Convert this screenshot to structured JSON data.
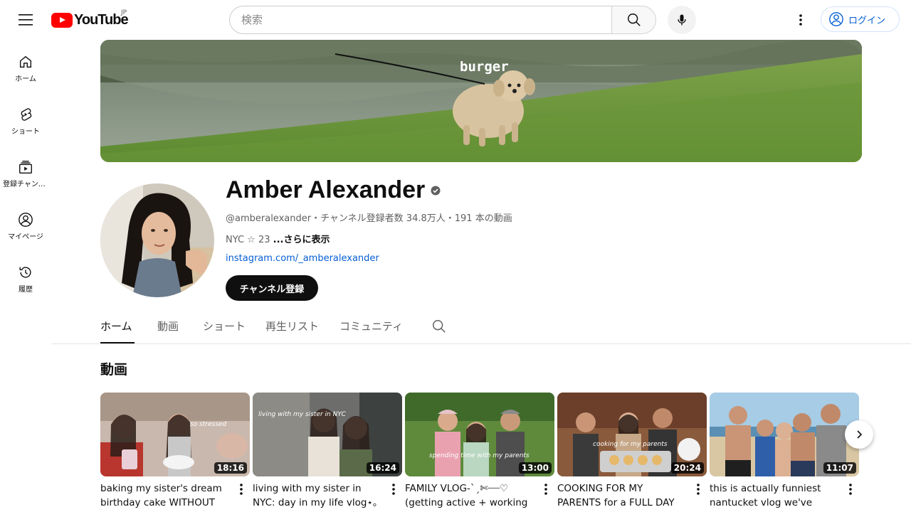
{
  "header": {
    "logo_text": "YouTube",
    "region": "JP",
    "search_placeholder": "検索",
    "login_label": "ログイン"
  },
  "sidebar": {
    "items": [
      {
        "label": "ホーム",
        "icon": "home-icon"
      },
      {
        "label": "ショート",
        "icon": "shorts-icon"
      },
      {
        "label": "登録チャンネル",
        "icon": "subscriptions-icon"
      },
      {
        "label": "マイページ",
        "icon": "profile-icon"
      },
      {
        "label": "履歴",
        "icon": "history-icon"
      }
    ]
  },
  "banner": {
    "caption": "burger"
  },
  "channel": {
    "name": "Amber Alexander",
    "meta": "@amberalexander・チャンネル登録者数 34.8万人・191 本の動画",
    "desc": "NYC ☆ 23 ",
    "desc_more": "...さらに表示",
    "link": "instagram.com/_amberalexander",
    "subscribe_label": "チャンネル登録"
  },
  "tabs": [
    "ホーム",
    "動画",
    "ショート",
    "再生リスト",
    "コミュニティ"
  ],
  "section": {
    "title": "動画"
  },
  "videos": [
    {
      "title": "baking my sister's dream birthday cake WITHOUT a...",
      "duration": "18:16",
      "caption": "so stressed"
    },
    {
      "title": "living with my sister in NYC: day in my life vlog⋆｡°✩",
      "duration": "16:24",
      "caption": "living with my sister in NYC"
    },
    {
      "title": "FAMILY VLOG-ˋˏ✄┈┈♡ (getting active + working out...",
      "duration": "13:00",
      "caption": "spending time with my parents"
    },
    {
      "title": "COOKING FOR MY PARENTS for a FULL DAY 🍓🍒 (famil...",
      "duration": "20:24",
      "caption": "cooking for my parents"
    },
    {
      "title": "this is actually funniest nantucket vlog we've ever...",
      "duration": "11:07",
      "caption": ""
    }
  ],
  "colors": {
    "brand_red": "#ff0000",
    "link_blue": "#065fd4",
    "text_primary": "#0f0f0f",
    "text_secondary": "#606060"
  }
}
